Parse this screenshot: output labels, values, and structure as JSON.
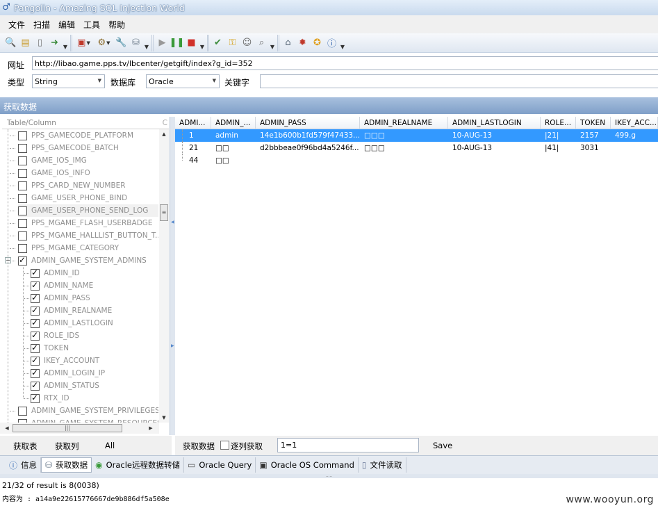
{
  "window": {
    "title": "Pangolin - Amazing SQL Injection World"
  },
  "menu": [
    "文件",
    "扫描",
    "编辑",
    "工具",
    "帮助"
  ],
  "toolbar": {
    "groups": [
      [
        "search-icon",
        "open-icon",
        "page-icon",
        "export-icon"
      ],
      [
        "form-dropdown-icon",
        "settings-dropdown-icon",
        "wrench-icon",
        "database-icon"
      ],
      [
        "play-icon",
        "pause-icon",
        "stop-icon"
      ],
      [
        "help-icon",
        "key-icon",
        "users-icon",
        "find-icon"
      ],
      [
        "home-icon",
        "bug-icon",
        "star-icon",
        "info-icon"
      ]
    ]
  },
  "address": {
    "label": "网址",
    "value": "http://libao.game.pps.tv/lbcenter/getgift/index?g_id=352"
  },
  "options": {
    "type_label": "类型",
    "type_value": "String",
    "db_label": "数据库",
    "db_value": "Oracle",
    "keyword_label": "关键字",
    "keyword_value": ""
  },
  "section_title": "获取数据",
  "tree": {
    "header": "Table/Column",
    "header_cut": "C",
    "items": [
      {
        "label": "PPS_GAMECODE_PLATFORM",
        "level": 0,
        "checked": false
      },
      {
        "label": "PPS_GAMECODE_BATCH",
        "level": 0,
        "checked": false
      },
      {
        "label": "GAME_IOS_IMG",
        "level": 0,
        "checked": false
      },
      {
        "label": "GAME_IOS_INFO",
        "level": 0,
        "checked": false
      },
      {
        "label": "PPS_CARD_NEW_NUMBER",
        "level": 0,
        "checked": false
      },
      {
        "label": "GAME_USER_PHONE_BIND",
        "level": 0,
        "checked": false
      },
      {
        "label": "GAME_USER_PHONE_SEND_LOG",
        "level": 0,
        "checked": false,
        "selected": true
      },
      {
        "label": "PPS_MGAME_FLASH_USERBADGE",
        "level": 0,
        "checked": false
      },
      {
        "label": "PPS_MGAME_HALLLIST_BUTTON_T...",
        "level": 0,
        "checked": false
      },
      {
        "label": "PPS_MGAME_CATEGORY",
        "level": 0,
        "checked": false
      },
      {
        "label": "ADMIN_GAME_SYSTEM_ADMINS",
        "level": 0,
        "checked": true,
        "expanded": true
      },
      {
        "label": "ADMIN_ID",
        "level": 1,
        "checked": true
      },
      {
        "label": "ADMIN_NAME",
        "level": 1,
        "checked": true
      },
      {
        "label": "ADMIN_PASS",
        "level": 1,
        "checked": true
      },
      {
        "label": "ADMIN_REALNAME",
        "level": 1,
        "checked": true
      },
      {
        "label": "ADMIN_LASTLOGIN",
        "level": 1,
        "checked": true
      },
      {
        "label": "ROLE_IDS",
        "level": 1,
        "checked": true
      },
      {
        "label": "TOKEN",
        "level": 1,
        "checked": true
      },
      {
        "label": "IKEY_ACCOUNT",
        "level": 1,
        "checked": true
      },
      {
        "label": "ADMIN_LOGIN_IP",
        "level": 1,
        "checked": true
      },
      {
        "label": "ADMIN_STATUS",
        "level": 1,
        "checked": true
      },
      {
        "label": "RTX_ID",
        "level": 1,
        "checked": true
      },
      {
        "label": "ADMIN_GAME_SYSTEM_PRIVILEGES",
        "level": 0,
        "checked": false
      },
      {
        "label": "ADMIN_GAME_SYSTEM_RESOURCES",
        "level": 0,
        "checked": false
      }
    ]
  },
  "grid": {
    "columns": [
      "ADMI...",
      "ADMIN_...",
      "ADMIN_PASS",
      "ADMIN_REALNAME",
      "ADMIN_LASTLOGIN",
      "ROLE...",
      "TOKEN",
      "IKEY_ACC..."
    ],
    "rows": [
      [
        "1",
        "admin",
        "14e1b600b1fd579f47433...",
        "□□□",
        "10-AUG-13",
        "|21|",
        "2157",
        "499.g"
      ],
      [
        "21",
        "□□",
        "d2bbbeae0f96bd4a5246f...",
        "□□□",
        "10-AUG-13",
        "|41|",
        "3031",
        ""
      ],
      [
        "44",
        "□□",
        "",
        "",
        "",
        "",
        "",
        ""
      ]
    ],
    "selected_row": 0
  },
  "left_actions": {
    "get_tables": "获取表",
    "get_columns": "获取列",
    "all": "All"
  },
  "right_actions": {
    "get_data": "获取数据",
    "by_row": "逐列获取",
    "condition": "1=1",
    "save": "Save"
  },
  "tabs": [
    {
      "label": "信息",
      "icon": "info-icon"
    },
    {
      "label": "获取数据",
      "icon": "database-icon",
      "active": true
    },
    {
      "label": "Oracle远程数据转储",
      "icon": "globe-icon"
    },
    {
      "label": "Oracle Query",
      "icon": "sql-icon"
    },
    {
      "label": "Oracle OS Command",
      "icon": "terminal-icon"
    },
    {
      "label": "文件读取",
      "icon": "file-icon"
    }
  ],
  "output": {
    "line1": "21/32 of result is 8(0038)",
    "line2": "内容为 : a14a9e22615776667de9b886df5a508e"
  },
  "watermark": "www.wooyun.org"
}
